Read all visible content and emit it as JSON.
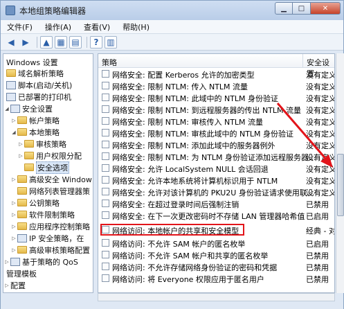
{
  "window": {
    "title": "本地组策略编辑器"
  },
  "menu": [
    "文件(F)",
    "操作(A)",
    "查看(V)",
    "帮助(H)"
  ],
  "tree": {
    "root": "Windows 设置",
    "items": [
      "域名解析策略",
      "脚本(启动/关机)",
      "已部署的打印机",
      "安全设置",
      "帐户策略",
      "本地策略",
      "审核策略",
      "用户权限分配",
      "安全选项",
      "高级安全 Window",
      "网络列表管理器策",
      "公钥策略",
      "软件限制策略",
      "应用程序控制策略",
      "IP 安全策略，在",
      "高级审核策略配置",
      "基于策略的 QoS",
      "管理模板",
      "配置"
    ]
  },
  "columns": {
    "policy": "策略",
    "setting": "安全设置"
  },
  "policies": [
    {
      "name": "网络安全: 配置 Kerberos 允许的加密类型",
      "setting": "没有定义"
    },
    {
      "name": "网络安全: 限制 NTLM: 传入 NTLM 流量",
      "setting": "没有定义"
    },
    {
      "name": "网络安全: 限制 NTLM: 此域中的 NTLM 身份验证",
      "setting": "没有定义"
    },
    {
      "name": "网络安全: 限制 NTLM: 到远程服务器的传出 NTLM 流量",
      "setting": "没有定义"
    },
    {
      "name": "网络安全: 限制 NTLM: 审核传入 NTLM 流量",
      "setting": "没有定义"
    },
    {
      "name": "网络安全: 限制 NTLM: 审核此域中的 NTLM 身份验证",
      "setting": "没有定义"
    },
    {
      "name": "网络安全: 限制 NTLM: 添加此域中的服务器例外",
      "setting": "没有定义"
    },
    {
      "name": "网络安全: 限制 NTLM: 为 NTLM 身份验证添加远程服务器...",
      "setting": "没有定义"
    },
    {
      "name": "网络安全: 允许 LocalSystem NULL 会话回退",
      "setting": "没有定义"
    },
    {
      "name": "网络安全: 允许本地系统将计算机标识用于 NTLM",
      "setting": "没有定义"
    },
    {
      "name": "网络安全: 允许对该计算机的 PKU2U 身份验证请求使用联...",
      "setting": "没有定义"
    },
    {
      "name": "网络安全: 在超过登录时间后强制注销",
      "setting": "已禁用"
    },
    {
      "name": "网络安全: 在下一次更改密码时不存储 LAN 管理器哈希值",
      "setting": "已启用"
    },
    {
      "name": "网络访问: 本地帐户的共享和安全模型",
      "setting": "经典 - 对"
    },
    {
      "name": "网络访问: 不允许 SAM 帐户的匿名枚举",
      "setting": "已启用"
    },
    {
      "name": "网络访问: 不允许 SAM 帐户和共享的匿名枚举",
      "setting": "已禁用"
    },
    {
      "name": "网络访问: 不允许存储网络身份验证的密码和凭据",
      "setting": "已禁用"
    },
    {
      "name": "网络访问: 将 Everyone 权限应用于匿名用户",
      "setting": "已禁用"
    }
  ],
  "colors": {
    "highlight": "#e2141a",
    "arrow": "#e2141a"
  }
}
